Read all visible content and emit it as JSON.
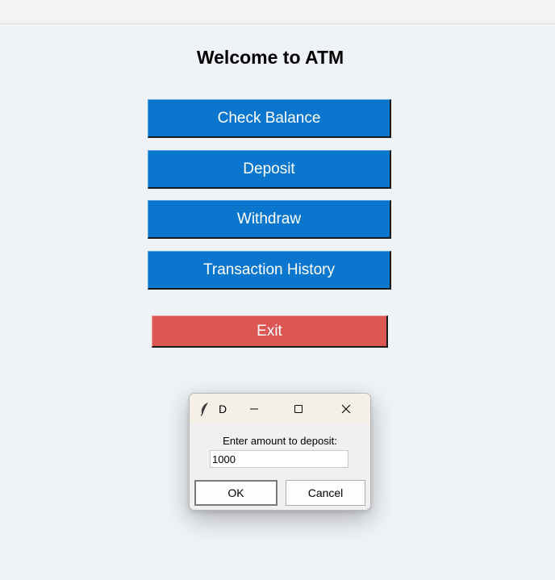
{
  "app": {
    "heading": "Welcome to ATM"
  },
  "menu": {
    "check_balance": "Check Balance",
    "deposit": "Deposit",
    "withdraw": "Withdraw",
    "transaction_history": "Transaction History",
    "exit": "Exit"
  },
  "dialog": {
    "title": "D",
    "prompt": "Enter amount to deposit:",
    "input_value": "1000",
    "ok_label": "OK",
    "cancel_label": "Cancel"
  },
  "icons": {
    "app_icon": "feather-icon",
    "minimize": "minimize-icon",
    "maximize": "maximize-icon",
    "close": "close-icon"
  },
  "colors": {
    "primary_button": "#0a76cd",
    "exit_button": "#dc5653",
    "background": "#eff2f6"
  }
}
